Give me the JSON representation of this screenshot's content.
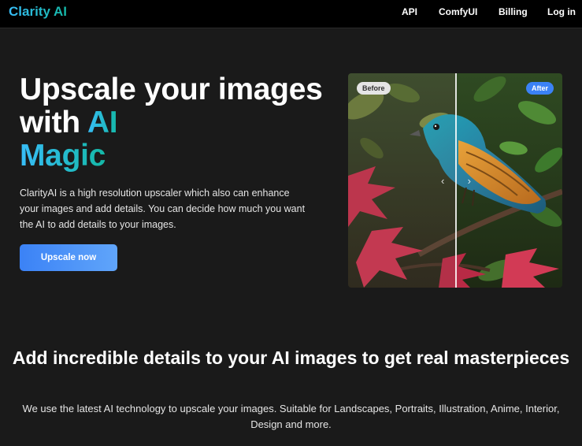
{
  "brand": "Clarity AI",
  "nav": {
    "api": "API",
    "comfyui": "ComfyUI",
    "billing": "Billing",
    "login": "Log in"
  },
  "hero": {
    "title_part1": "Upscale your images with ",
    "title_highlight_1": "AI",
    "title_highlight_2": "Magic",
    "description": "ClarityAI is a high resolution upscaler which also can enhance your images and add details. You can decide how much you want the AI to add details to your images.",
    "cta_label": "Upscale now"
  },
  "comparison": {
    "before_label": "Before",
    "after_label": "After",
    "handle_left": "‹",
    "handle_right": "›"
  },
  "section": {
    "title": "Add incredible details to your AI images to get real masterpieces",
    "description": "We use the latest AI technology to upscale your images. Suitable for Landscapes, Portraits, Illustration, Anime, Interior, Design and more."
  },
  "colors": {
    "accent_gradient_start": "#38bdf8",
    "accent_gradient_end": "#14b8a6",
    "button_blue": "#3b82f6",
    "background": "#1a1a1a"
  }
}
